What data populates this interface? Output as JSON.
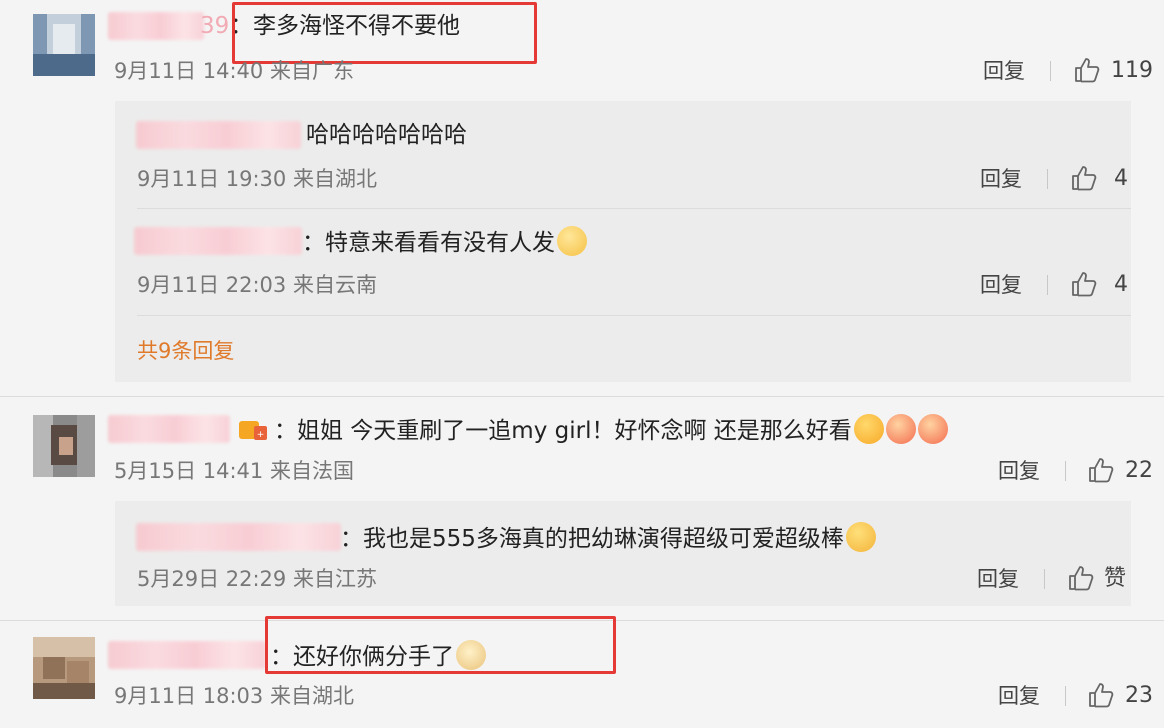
{
  "comments": [
    {
      "text": "：李多海怪不得不要他",
      "meta": "9月11日 14:40 来自广东",
      "reply_label": "回复",
      "likes": "119",
      "replies": [
        {
          "text": "哈哈哈哈哈哈哈",
          "meta": "9月11日 19:30 来自湖北",
          "reply_label": "回复",
          "likes": "4"
        },
        {
          "text": "：特意来看看有没有人发",
          "meta": "9月11日 22:03 来自云南",
          "reply_label": "回复",
          "likes": "4"
        }
      ],
      "more_label": "共9条回复"
    },
    {
      "text": "：姐姐 今天重刷了一追my girl！好怀念啊 还是那么好看",
      "meta": "5月15日 14:41 来自法国",
      "reply_label": "回复",
      "likes": "22",
      "replies": [
        {
          "text": "：我也是555多海真的把幼琳演得超级可爱超级棒",
          "meta": "5月29日 22:29 来自江苏",
          "reply_label": "回复",
          "likes": "赞"
        }
      ]
    },
    {
      "text": "：还好你俩分手了",
      "meta": "9月11日 18:03 来自湖北",
      "reply_label": "回复",
      "likes": "23"
    }
  ],
  "partial_name_suffix": "39",
  "colors": {
    "highlight_box": "#e53935",
    "more_link": "#e07a2b"
  }
}
